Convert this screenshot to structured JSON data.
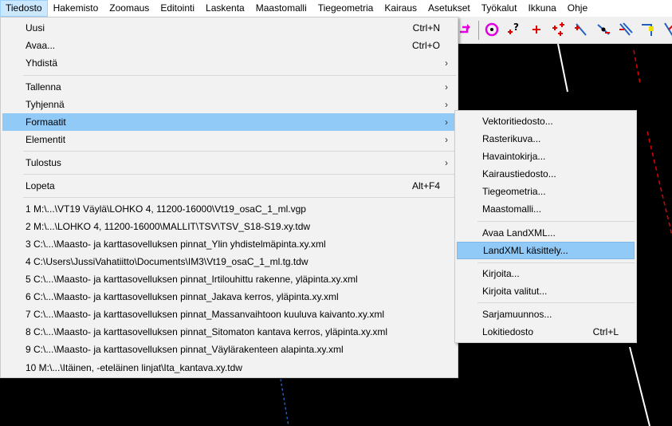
{
  "menubar": [
    "Tiedosto",
    "Hakemisto",
    "Zoomaus",
    "Editointi",
    "Laskenta",
    "Maastomalli",
    "Tiegeometria",
    "Kairaus",
    "Asetukset",
    "Työkalut",
    "Ikkuna",
    "Ohje"
  ],
  "file_menu": {
    "items": [
      {
        "label": "Uusi",
        "shortcut": "Ctrl+N"
      },
      {
        "label": "Avaa...",
        "shortcut": "Ctrl+O"
      },
      {
        "label": "Yhdistä",
        "submenu": true
      },
      {
        "label": "Tallenna",
        "submenu": true
      },
      {
        "label": "Tyhjennä",
        "submenu": true
      },
      {
        "label": "Formaatit",
        "submenu": true,
        "highlighted": true
      },
      {
        "label": "Elementit",
        "submenu": true
      },
      {
        "label": "Tulostus",
        "submenu": true
      },
      {
        "label": "Lopeta",
        "shortcut": "Alt+F4"
      }
    ],
    "recent": [
      "1 M:\\...\\VT19 Väylä\\LOHKO 4, 11200-16000\\Vt19_osaC_1_ml.vgp",
      "2 M:\\...\\LOHKO 4, 11200-16000\\MALLIT\\TSV\\TSV_S18-S19.xy.tdw",
      "3 C:\\...\\Maasto- ja karttasovelluksen pinnat_Ylin yhdistelmäpinta.xy.xml",
      "4 C:\\Users\\JussiVahatiitto\\Documents\\IM3\\Vt19_osaC_1_ml.tg.tdw",
      "5 C:\\...\\Maasto- ja karttasovelluksen pinnat_Irtilouhittu rakenne, yläpinta.xy.xml",
      "6 C:\\...\\Maasto- ja karttasovelluksen pinnat_Jakava kerros, yläpinta.xy.xml",
      "7 C:\\...\\Maasto- ja karttasovelluksen pinnat_Massanvaihtoon kuuluva kaivanto.xy.xml",
      "8 C:\\...\\Maasto- ja karttasovelluksen pinnat_Sitomaton kantava kerros, yläpinta.xy.xml",
      "9 C:\\...\\Maasto- ja karttasovelluksen pinnat_Väylärakenteen alapinta.xy.xml",
      "10 M:\\...\\Itäinen, -eteläinen linjat\\Ita_kantava.xy.tdw"
    ]
  },
  "formats_submenu": {
    "items": [
      {
        "label": "Vektoritiedosto..."
      },
      {
        "label": "Rasterikuva..."
      },
      {
        "label": "Havaintokirja..."
      },
      {
        "label": "Kairaustiedosto..."
      },
      {
        "label": "Tiegeometria..."
      },
      {
        "label": "Maastomalli..."
      },
      {
        "label": "Avaa LandXML..."
      },
      {
        "label": "LandXML käsittely...",
        "highlighted": true
      },
      {
        "label": "Kirjoita..."
      },
      {
        "label": "Kirjoita valitut..."
      },
      {
        "label": "Sarjamuunnos..."
      },
      {
        "label": "Lokitiedosto",
        "shortcut": "Ctrl+L"
      }
    ]
  },
  "toolbar_icons": [
    "redo-arrow-icon",
    "target-circle-icon",
    "point-query-icon",
    "add-point-icon",
    "add-points-icon",
    "line-tool-icon",
    "line-node-icon",
    "parallel-lines-icon",
    "corner-tool-icon",
    "slash-tool-icon"
  ],
  "colors": {
    "accent_highlight": "#91c9f7",
    "menubar_active": "#cce8ff",
    "canvas": "#000000",
    "toolbar_magenta": "#e000e0",
    "toolbar_red": "#e00000",
    "toolbar_blue": "#2060c0"
  }
}
